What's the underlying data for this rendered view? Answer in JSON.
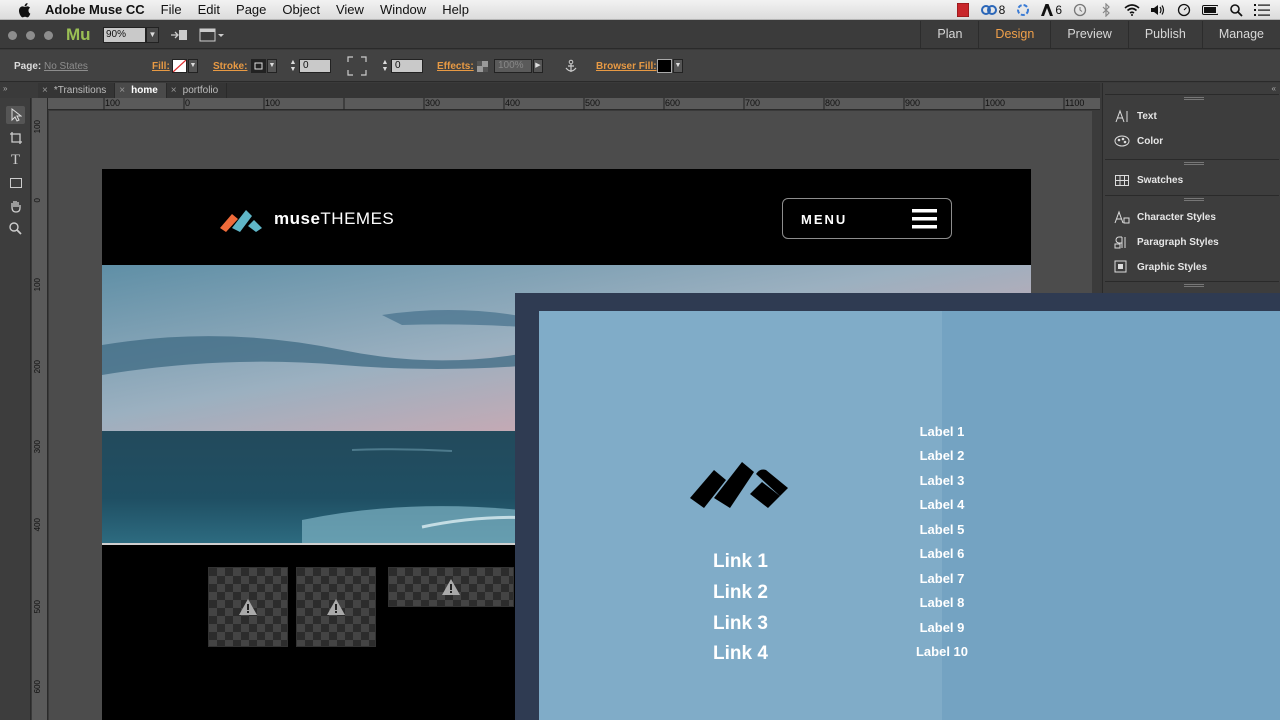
{
  "menubar": {
    "app_name": "Adobe Muse CC",
    "items": [
      "File",
      "Edit",
      "Page",
      "Object",
      "View",
      "Window",
      "Help"
    ],
    "status": {
      "cc_count": "8",
      "adobe_count": "6"
    }
  },
  "appbar": {
    "logo": "Mu",
    "zoom": "90%",
    "modes": [
      "Plan",
      "Design",
      "Preview",
      "Publish",
      "Manage"
    ],
    "active_mode": "Design",
    "accent_color": "#f0a04a"
  },
  "controlbar": {
    "page_label": "Page:",
    "page_state": "No States",
    "fill_label": "Fill:",
    "stroke_label": "Stroke:",
    "stroke_value": "0",
    "corner_value": "0",
    "effects_label": "Effects:",
    "opacity": "100%",
    "browser_fill_label": "Browser Fill:"
  },
  "tabs": [
    {
      "label": "*Transitions",
      "active": false
    },
    {
      "label": "home",
      "active": true
    },
    {
      "label": "portfolio",
      "active": false
    }
  ],
  "ruler_h": [
    "100",
    "0",
    "100",
    "300",
    "400",
    "500",
    "600",
    "700",
    "800",
    "900",
    "1000",
    "1100"
  ],
  "ruler_v": [
    "100",
    "0",
    "100",
    "200",
    "300",
    "400",
    "500",
    "600"
  ],
  "site": {
    "logo_bold": "muse",
    "logo_light": "THEMES",
    "menu_label": "MENU",
    "brand_orange": "#ef6b3a",
    "brand_teal": "#5fb6c8"
  },
  "panels": {
    "group1": [
      "Text",
      "Color"
    ],
    "group2": [
      "Swatches"
    ],
    "group3": [
      "Character Styles",
      "Paragraph Styles",
      "Graphic Styles"
    ]
  },
  "overlay": {
    "links": [
      "Link 1",
      "Link 2",
      "Link 3",
      "Link 4"
    ],
    "labels": [
      "Label 1",
      "Label 2",
      "Label 3",
      "Label 4",
      "Label 5",
      "Label 6",
      "Label 7",
      "Label 8",
      "Label 9",
      "Label 10"
    ],
    "bg_dark": "#2f3b52",
    "bg_left": "#80acc8",
    "bg_right": "#74a3c2"
  }
}
